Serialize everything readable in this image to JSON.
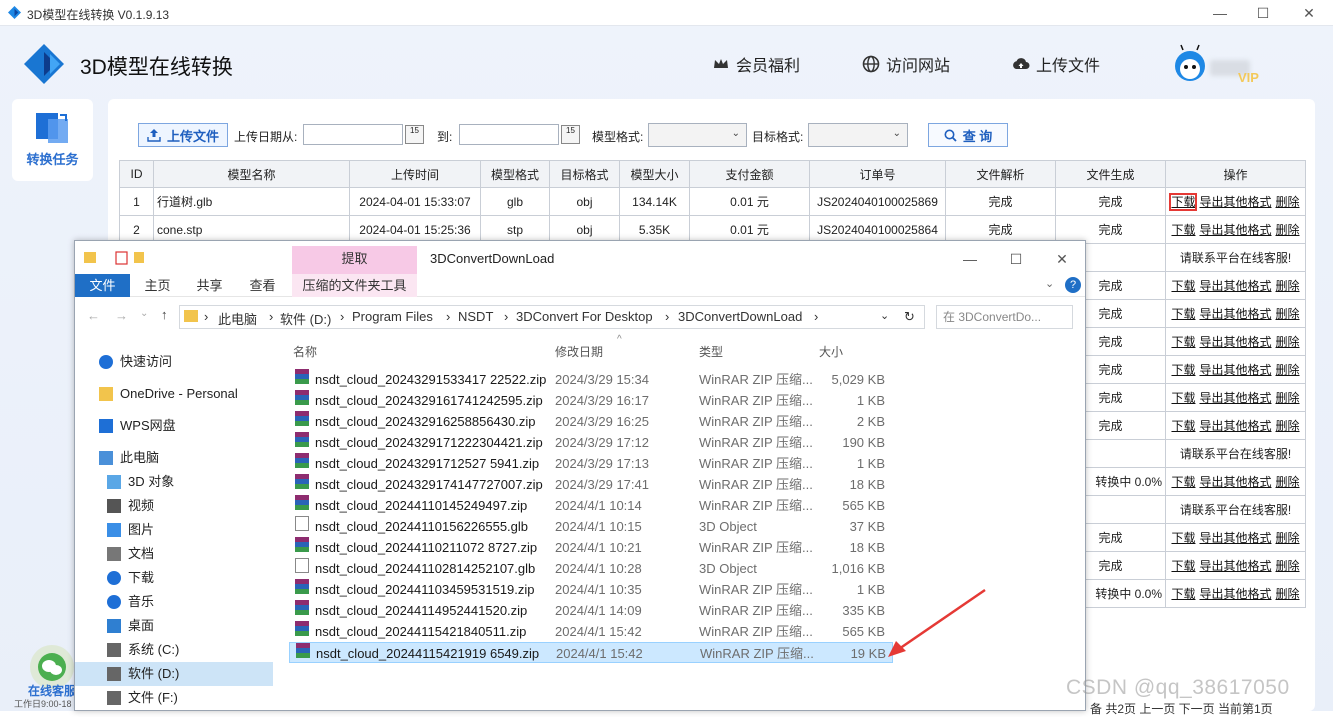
{
  "window": {
    "title": "3D模型在线转换 V0.1.9.13"
  },
  "header": {
    "brand": "3D模型在线转换",
    "nav": [
      {
        "label": "会员福利",
        "icon": "crown-icon"
      },
      {
        "label": "访问网站",
        "icon": "globe-icon"
      },
      {
        "label": "上传文件",
        "icon": "cloud-upload-icon"
      }
    ],
    "vip": "VIP"
  },
  "sidebar": {
    "item": "转换任务",
    "service": "在线客服",
    "service_hours": "工作日9:00-18"
  },
  "toolbar": {
    "upload": "上传文件",
    "date_from": "上传日期从:",
    "date_to": "到:",
    "cal_text": "15",
    "model_format": "模型格式:",
    "target_format": "目标格式:",
    "search": "查 询"
  },
  "table": {
    "headers": [
      "ID",
      "模型名称",
      "上传时间",
      "模型格式",
      "目标格式",
      "模型大小",
      "支付金额",
      "订单号",
      "文件解析",
      "文件生成",
      "操作"
    ],
    "rows": [
      {
        "id": "1",
        "name": "行道树.glb",
        "time": "2024-04-01 15:33:07",
        "fmt": "glb",
        "target": "obj",
        "size": "134.14K",
        "pay": "0.01 元",
        "order": "JS2024040100025869",
        "parse": "完成",
        "gen": "完成"
      },
      {
        "id": "2",
        "name": "cone.stp",
        "time": "2024-04-01 15:25:36",
        "fmt": "stp",
        "target": "obj",
        "size": "5.35K",
        "pay": "0.01 元",
        "order": "JS2024040100025864",
        "parse": "完成",
        "gen": "完成"
      }
    ],
    "hidden_rows": [
      {
        "gen": "",
        "op": "请联系平台在线客服!"
      },
      {
        "gen": "完成",
        "op": "ops"
      },
      {
        "gen": "完成",
        "op": "ops"
      },
      {
        "gen": "完成",
        "op": "ops"
      },
      {
        "gen": "完成",
        "op": "ops"
      },
      {
        "gen": "完成",
        "op": "ops"
      },
      {
        "gen": "完成",
        "op": "ops"
      },
      {
        "gen": "",
        "op": "请联系平台在线客服!"
      },
      {
        "gen": "转换中 0.0%",
        "op": "ops"
      },
      {
        "gen": "",
        "op": "请联系平台在线客服!"
      },
      {
        "gen": "完成",
        "op": "ops"
      },
      {
        "gen": "完成",
        "op": "ops"
      },
      {
        "gen": "转换中 0.0%",
        "op": "ops"
      }
    ],
    "actions": {
      "download": "下载",
      "export": "导出其他格式",
      "delete": "删除"
    }
  },
  "explorer": {
    "title": "3DConvertDownLoad",
    "context_tab": "提取",
    "context_tool": "压缩的文件夹工具",
    "ribbon": [
      "文件",
      "主页",
      "共享",
      "查看"
    ],
    "breadcrumb": [
      "此电脑",
      "软件 (D:)",
      "Program Files",
      "NSDT",
      "3DConvert For Desktop",
      "3DConvertDownLoad"
    ],
    "search_placeholder": "在 3DConvertDo...",
    "columns": [
      "名称",
      "修改日期",
      "类型",
      "大小"
    ],
    "nav": [
      {
        "label": "快速访问",
        "icon": "star-icon"
      },
      {
        "label": "OneDrive - Personal",
        "icon": "folder-icon"
      },
      {
        "label": "WPS网盘",
        "icon": "cloud-icon"
      },
      {
        "label": "此电脑",
        "icon": "pc-icon"
      },
      {
        "label": "3D 对象",
        "icon": "cube-icon"
      },
      {
        "label": "视频",
        "icon": "video-icon"
      },
      {
        "label": "图片",
        "icon": "image-icon"
      },
      {
        "label": "文档",
        "icon": "document-icon"
      },
      {
        "label": "下载",
        "icon": "download-icon"
      },
      {
        "label": "音乐",
        "icon": "music-icon"
      },
      {
        "label": "桌面",
        "icon": "desktop-icon"
      },
      {
        "label": "系统 (C:)",
        "icon": "drive-icon"
      },
      {
        "label": "软件 (D:)",
        "icon": "drive-icon"
      },
      {
        "label": "文件 (F:)",
        "icon": "drive-icon"
      }
    ],
    "files": [
      {
        "name": "nsdt_cloud_20243291533417 22522.zip",
        "date": "2024/3/29 15:34",
        "type": "WinRAR ZIP 压缩...",
        "size": "5,029 KB",
        "kind": "zip"
      },
      {
        "name": "nsdt_cloud_2024329161741242595.zip",
        "date": "2024/3/29 16:17",
        "type": "WinRAR ZIP 压缩...",
        "size": "1 KB",
        "kind": "zip"
      },
      {
        "name": "nsdt_cloud_202432916258856430.zip",
        "date": "2024/3/29 16:25",
        "type": "WinRAR ZIP 压缩...",
        "size": "2 KB",
        "kind": "zip"
      },
      {
        "name": "nsdt_cloud_2024329171222304421.zip",
        "date": "2024/3/29 17:12",
        "type": "WinRAR ZIP 压缩...",
        "size": "190 KB",
        "kind": "zip"
      },
      {
        "name": "nsdt_cloud_20243291712527 5941.zip",
        "date": "2024/3/29 17:13",
        "type": "WinRAR ZIP 压缩...",
        "size": "1 KB",
        "kind": "zip"
      },
      {
        "name": "nsdt_cloud_2024329174147727007.zip",
        "date": "2024/3/29 17:41",
        "type": "WinRAR ZIP 压缩...",
        "size": "18 KB",
        "kind": "zip"
      },
      {
        "name": "nsdt_cloud_20244110145249497.zip",
        "date": "2024/4/1 10:14",
        "type": "WinRAR ZIP 压缩...",
        "size": "565 KB",
        "kind": "zip"
      },
      {
        "name": "nsdt_cloud_20244110156226555.glb",
        "date": "2024/4/1 10:15",
        "type": "3D Object",
        "size": "37 KB",
        "kind": "glb"
      },
      {
        "name": "nsdt_cloud_20244110211072 8727.zip",
        "date": "2024/4/1 10:21",
        "type": "WinRAR ZIP 压缩...",
        "size": "18 KB",
        "kind": "zip"
      },
      {
        "name": "nsdt_cloud_202441102814252107.glb",
        "date": "2024/4/1 10:28",
        "type": "3D Object",
        "size": "1,016 KB",
        "kind": "glb"
      },
      {
        "name": "nsdt_cloud_202441103459531519.zip",
        "date": "2024/4/1 10:35",
        "type": "WinRAR ZIP 压缩...",
        "size": "1 KB",
        "kind": "zip"
      },
      {
        "name": "nsdt_cloud_20244114952441520.zip",
        "date": "2024/4/1 14:09",
        "type": "WinRAR ZIP 压缩...",
        "size": "335 KB",
        "kind": "zip"
      },
      {
        "name": "nsdt_cloud_20244115421840511.zip",
        "date": "2024/4/1 15:42",
        "type": "WinRAR ZIP 压缩...",
        "size": "565 KB",
        "kind": "zip"
      },
      {
        "name": "nsdt_cloud_20244115421919 6549.zip",
        "date": "2024/4/1 15:42",
        "type": "WinRAR ZIP 压缩...",
        "size": "19 KB",
        "kind": "zip"
      }
    ]
  },
  "watermark": "CSDN @qq_38617050",
  "pager": "备 共2页 上一页 下一页 当前第1页"
}
